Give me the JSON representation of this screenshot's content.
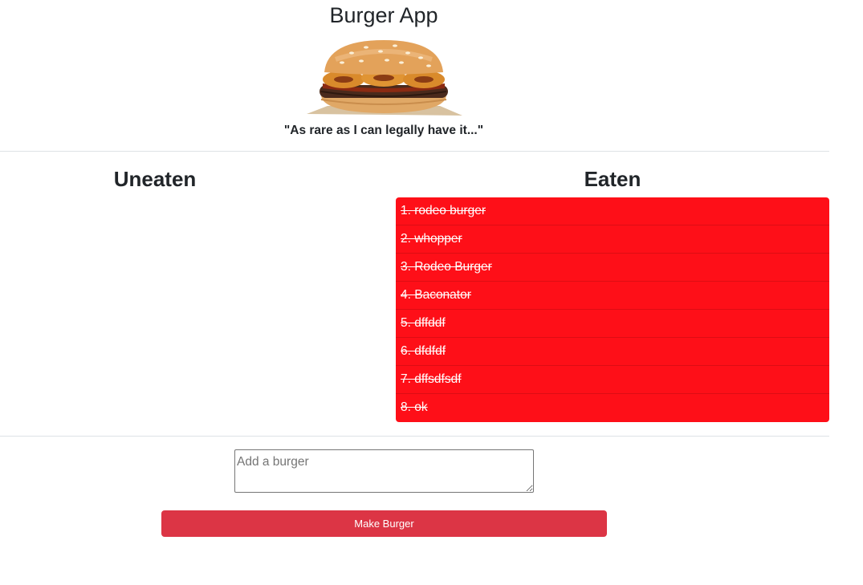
{
  "header": {
    "title": "Burger App",
    "tagline": "\"As rare as I can legally have it...\""
  },
  "columns": {
    "uneaten_title": "Uneaten",
    "eaten_title": "Eaten"
  },
  "uneaten_burgers": [],
  "eaten_burgers": [
    "1. rodeo burger",
    "2. whopper",
    "3. Rodeo Burger",
    "4. Baconator",
    "5. dffddf",
    "6. dfdfdf",
    "7. dffsdfsdf",
    "8. ok"
  ],
  "form": {
    "input_placeholder": "Add a burger",
    "input_value": "",
    "submit_label": "Make Burger"
  },
  "colors": {
    "eaten_bg": "#fe0f18",
    "button_bg": "#dc3545"
  }
}
